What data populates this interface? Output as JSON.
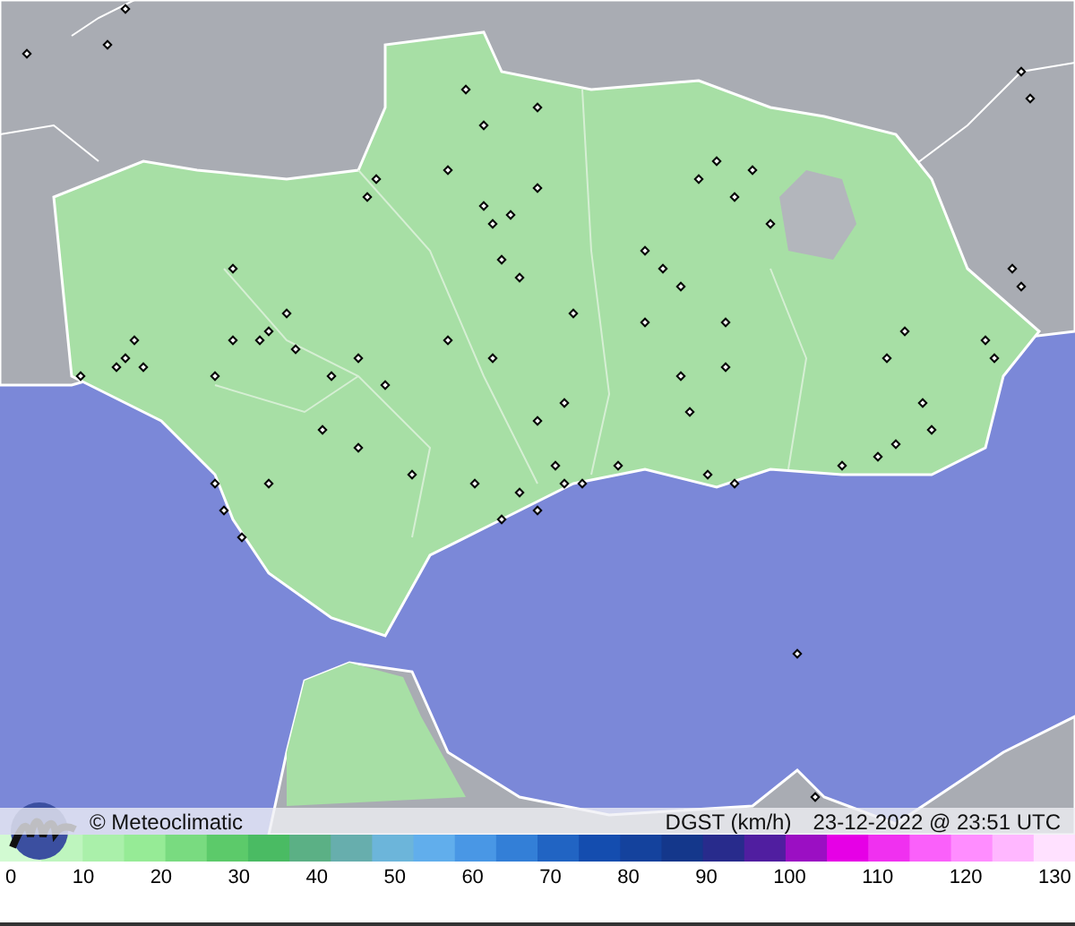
{
  "map": {
    "credit": "© Meteoclimatic",
    "variable": "DGST (km/h)",
    "timestamp": "23-12-2022 @ 23:51 UTC"
  },
  "legend": {
    "labels": [
      "0",
      "10",
      "20",
      "30",
      "40",
      "50",
      "60",
      "70",
      "80",
      "90",
      "100",
      "110",
      "120",
      "130"
    ]
  }
}
